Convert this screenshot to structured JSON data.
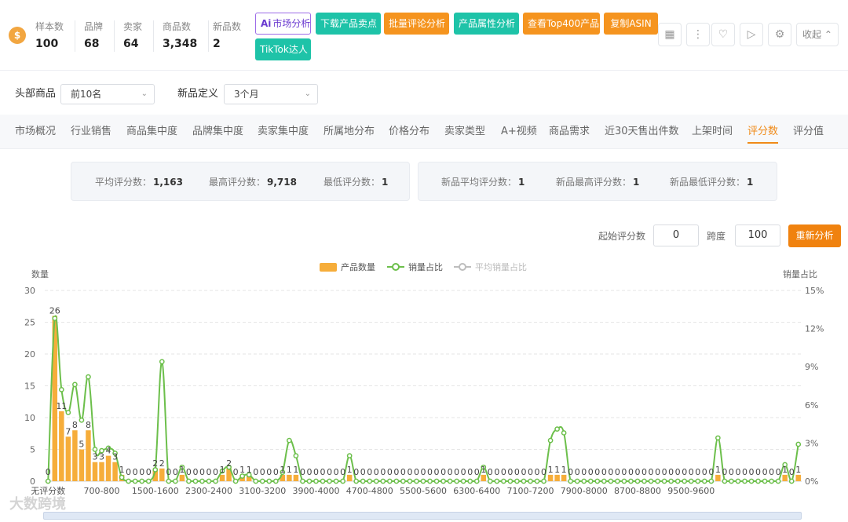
{
  "topbar": {
    "logo": "$",
    "stats": [
      {
        "label": "样本数",
        "value": "100"
      },
      {
        "label": "品牌",
        "value": "68"
      },
      {
        "label": "卖家",
        "value": "64"
      },
      {
        "label": "商品数",
        "value": "3,348"
      },
      {
        "label": "新品数",
        "value": "2"
      }
    ],
    "ai_prefix": "Ai",
    "buttons": [
      "市场分析",
      "下载产品卖点",
      "批量评论分析",
      "产品属性分析",
      "查看Top400产品",
      "复制ASIN",
      "TikTok达人"
    ],
    "collapse_label": "收起",
    "icons": [
      "apps-icon",
      "more-icon",
      "heart-icon",
      "video-icon",
      "settings-icon"
    ]
  },
  "filters": {
    "head_label": "头部商品",
    "head_value": "前10名",
    "new_label": "新品定义",
    "new_value": "3个月"
  },
  "tabs": [
    "市场概况",
    "行业销售",
    "商品集中度",
    "品牌集中度",
    "卖家集中度",
    "所属地分布",
    "价格分布",
    "卖家类型",
    "A+视频",
    "商品需求",
    "近30天售出件数",
    "上架时间",
    "评分数",
    "评分值"
  ],
  "active_tab": "评分数",
  "summary": {
    "all": [
      {
        "label": "平均评分数：",
        "value": "1,163"
      },
      {
        "label": "最高评分数：",
        "value": "9,718"
      },
      {
        "label": "最低评分数：",
        "value": "1"
      }
    ],
    "new": [
      {
        "label": "新品平均评分数：",
        "value": "1"
      },
      {
        "label": "新品最高评分数：",
        "value": "1"
      },
      {
        "label": "新品最低评分数：",
        "value": "1"
      }
    ]
  },
  "controls": {
    "start_label": "起始评分数",
    "start_value": "0",
    "span_label": "跨度",
    "span_value": "100",
    "reanalyze": "重新分析"
  },
  "watermark": "大数跨境",
  "colors": {
    "bar": "#f6ad3a",
    "line": "#6cbf4b",
    "avg_line": "#bdbdbd",
    "accent": "#f0820f",
    "teal": "#1ec3a8"
  },
  "chart_data": {
    "type": "bar",
    "ylabel": "数量",
    "y2label": "销量占比",
    "ylim": [
      0,
      30
    ],
    "y2lim": [
      0,
      15
    ],
    "yticks": [
      0,
      5,
      10,
      15,
      20,
      25,
      30
    ],
    "y2ticks": [
      "0%",
      "3%",
      "6%",
      "9%",
      "12%",
      "15%"
    ],
    "grid": true,
    "legend_position": "top-center",
    "legend": [
      "产品数量",
      "销量占比",
      "平均销量占比"
    ],
    "x_tick_labels": [
      "无评分数",
      "700-800",
      "1500-1600",
      "2300-2400",
      "3100-3200",
      "3900-4000",
      "4700-4800",
      "5500-5600",
      "6300-6400",
      "7100-7200",
      "7900-8000",
      "8700-8800",
      "9500-9600"
    ],
    "x_tick_index": [
      0,
      8,
      16,
      24,
      32,
      40,
      48,
      56,
      64,
      72,
      80,
      88,
      96
    ],
    "series": [
      {
        "name": "产品数量",
        "type": "bar",
        "axis": "left",
        "values": [
          0,
          26,
          11,
          7,
          8,
          5,
          8,
          3,
          3,
          4,
          3,
          1,
          0,
          0,
          0,
          0,
          2,
          2,
          0,
          0,
          1,
          0,
          0,
          0,
          0,
          0,
          1,
          2,
          0,
          1,
          1,
          0,
          0,
          0,
          0,
          1,
          1,
          1,
          0,
          0,
          0,
          0,
          0,
          0,
          0,
          1,
          0,
          0,
          0,
          0,
          0,
          0,
          0,
          0,
          0,
          0,
          0,
          0,
          0,
          0,
          0,
          0,
          0,
          0,
          0,
          1,
          0,
          0,
          0,
          0,
          0,
          0,
          0,
          0,
          0,
          1,
          1,
          1,
          0,
          0,
          0,
          0,
          0,
          0,
          0,
          0,
          0,
          0,
          0,
          0,
          0,
          0,
          0,
          0,
          0,
          0,
          0,
          0,
          0,
          0,
          1,
          0,
          0,
          0,
          0,
          0,
          0,
          0,
          0,
          0,
          1,
          0,
          1
        ]
      },
      {
        "name": "销量占比",
        "type": "line",
        "axis": "right",
        "values": [
          0,
          12.8,
          7.2,
          5.4,
          7.6,
          4.8,
          8.2,
          2.5,
          2.4,
          2.6,
          2.2,
          0.3,
          0,
          0,
          0,
          0,
          0.9,
          9.4,
          0,
          0,
          1.1,
          0,
          0,
          0,
          0,
          0,
          0.8,
          1.1,
          0,
          0.4,
          0.5,
          0,
          0,
          0,
          0,
          0.7,
          3.2,
          2.0,
          0,
          0,
          0,
          0,
          0,
          0,
          0,
          2.0,
          0,
          0,
          0,
          0,
          0,
          0,
          0,
          0,
          0,
          0,
          0,
          0,
          0,
          0,
          0,
          0,
          0,
          0,
          0,
          1.1,
          0,
          0,
          0,
          0,
          0,
          0,
          0,
          0,
          0,
          3.2,
          4.1,
          3.8,
          0,
          0,
          0,
          0,
          0,
          0,
          0,
          0,
          0,
          0,
          0,
          0,
          0,
          0,
          0,
          0,
          0,
          0,
          0,
          0,
          0,
          0,
          3.4,
          0,
          0,
          0,
          0,
          0,
          0,
          0,
          0,
          0,
          1.3,
          0,
          2.9
        ]
      }
    ]
  }
}
